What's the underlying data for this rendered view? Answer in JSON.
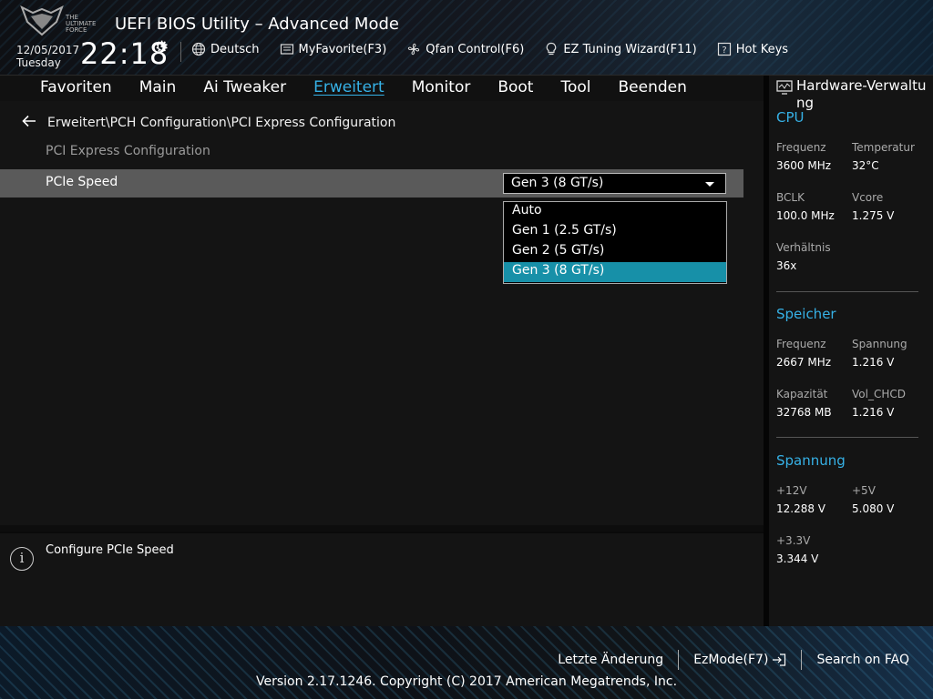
{
  "header": {
    "brand_line1": "THE",
    "brand_line2": "ULTIMATE",
    "brand_line3": "FORCE",
    "app_title": "UEFI BIOS Utility – Advanced Mode",
    "date": "12/05/2017",
    "weekday": "Tuesday",
    "time": "22:18",
    "toolbar": [
      {
        "icon": "globe-icon",
        "label": "Deutsch"
      },
      {
        "icon": "favorite-icon",
        "label": "MyFavorite(F3)"
      },
      {
        "icon": "fan-icon",
        "label": "Qfan Control(F6)"
      },
      {
        "icon": "bulb-icon",
        "label": "EZ Tuning Wizard(F11)"
      },
      {
        "icon": "help-icon",
        "label": "Hot Keys"
      }
    ]
  },
  "nav": {
    "tabs": [
      "Favoriten",
      "Main",
      "Ai Tweaker",
      "Erweitert",
      "Monitor",
      "Boot",
      "Tool",
      "Beenden"
    ],
    "active": "Erweitert"
  },
  "main": {
    "breadcrumb": "Erweitert\\PCH Configuration\\PCI Express Configuration",
    "subheading": "PCI Express Configuration",
    "setting_label": "PCIe Speed",
    "setting_value": "Gen 3 (8 GT/s)",
    "options": [
      "Auto",
      "Gen 1 (2.5 GT/s)",
      "Gen 2 (5 GT/s)",
      "Gen 3 (8 GT/s)"
    ],
    "selected_option": "Gen 3 (8 GT/s)"
  },
  "help": {
    "icon": "info-icon",
    "text": "Configure PCIe Speed"
  },
  "hardware": {
    "title": "Hardware-Verwaltung",
    "cpu": {
      "title": "CPU",
      "freq_label": "Frequenz",
      "freq_value": "3600 MHz",
      "temp_label": "Temperatur",
      "temp_value": "32°C",
      "bclk_label": "BCLK",
      "bclk_value": "100.0 MHz",
      "vcore_label": "Vcore",
      "vcore_value": "1.275 V",
      "ratio_label": "Verhältnis",
      "ratio_value": "36x"
    },
    "memory": {
      "title": "Speicher",
      "freq_label": "Frequenz",
      "freq_value": "2667 MHz",
      "volt_label": "Spannung",
      "volt_value": "1.216 V",
      "cap_label": "Kapazität",
      "cap_value": "32768 MB",
      "chcd_label": "Vol_CHCD",
      "chcd_value": "1.216 V"
    },
    "voltage": {
      "title": "Spannung",
      "v12_label": "+12V",
      "v12_value": "12.288 V",
      "v5_label": "+5V",
      "v5_value": "5.080 V",
      "v33_label": "+3.3V",
      "v33_value": "3.344 V"
    }
  },
  "footer": {
    "last_change": "Letzte Änderung",
    "ezmode": "EzMode(F7)",
    "search_faq": "Search on FAQ",
    "copyright": "Version 2.17.1246. Copyright (C) 2017 American Megatrends, Inc."
  },
  "colors": {
    "accent": "#36b1e6",
    "selected_option": "#1790a8",
    "setting_row": "#5a5a5a"
  }
}
